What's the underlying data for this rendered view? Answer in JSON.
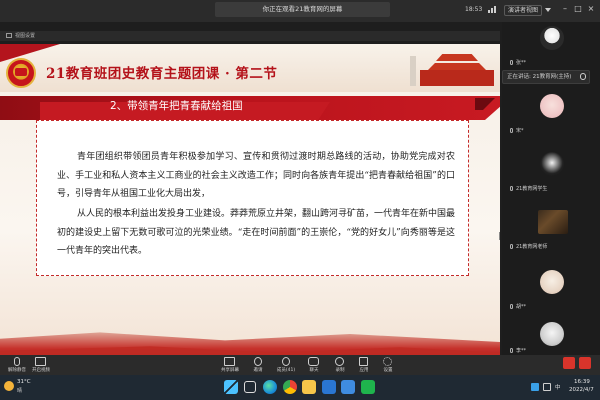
{
  "topbar": {
    "share_banner": "你正在观看21教育网的屏幕",
    "time": "18:53",
    "reception": "演讲者视图"
  },
  "viewer": {
    "label": "视图设置"
  },
  "slide": {
    "title": "21教育班团史教育主题团课 · 第二节",
    "section_title": "2、带领青年把青春献给祖国",
    "paragraph1": "青年团组织带领团员青年积极参加学习、宣传和贯彻过渡时期总路线的活动，协助党完成对农业、手工业和私人资本主义工商业的社会主义改造工作；同时向各族青年提出“把青春献给祖国”的口号，引导青年从祖国工业化大局出发，",
    "paragraph2": "从人民的根本利益出发投身工业建设。莽莽荒原立井架，翻山跨河寻矿苗，一代青年在新中国最初的建设史上留下无数可歌可泣的光荣业绩。“走在时间前面”的王崇伦，“党的好女儿”向秀丽等是这一代青年的突出代表。"
  },
  "right_panel": {
    "speaking": "正在讲话: 21教育网(主持)",
    "participants": [
      {
        "name": "张**"
      },
      {
        "name": "宋*"
      },
      {
        "name": "21教育网学生"
      },
      {
        "name": "21教育网老师"
      },
      {
        "name": "胡**"
      },
      {
        "name": "李**"
      }
    ]
  },
  "toolbar": {
    "items": [
      {
        "label": "解除静音",
        "icon": "mic-icon"
      },
      {
        "label": "开启视频",
        "icon": "camera-icon"
      },
      {
        "label": "共享屏幕",
        "icon": "share-screen-icon"
      },
      {
        "label": "邀请",
        "icon": "invite-icon"
      },
      {
        "label": "成员(41)",
        "icon": "users-icon"
      },
      {
        "label": "聊天",
        "icon": "chat-icon"
      },
      {
        "label": "录制",
        "icon": "record-icon"
      },
      {
        "label": "应用",
        "icon": "apps-icon"
      },
      {
        "label": "设置",
        "icon": "gear-icon"
      }
    ]
  },
  "taskbar": {
    "weather_temp": "31°C",
    "weather_desc": "晴",
    "tray_lang": "中",
    "clock_time": "16:39",
    "clock_date": "2022/4/7"
  },
  "colors": {
    "accent_red": "#c51a22",
    "title_red": "#b4121a",
    "box_border": "#c42a2a"
  }
}
